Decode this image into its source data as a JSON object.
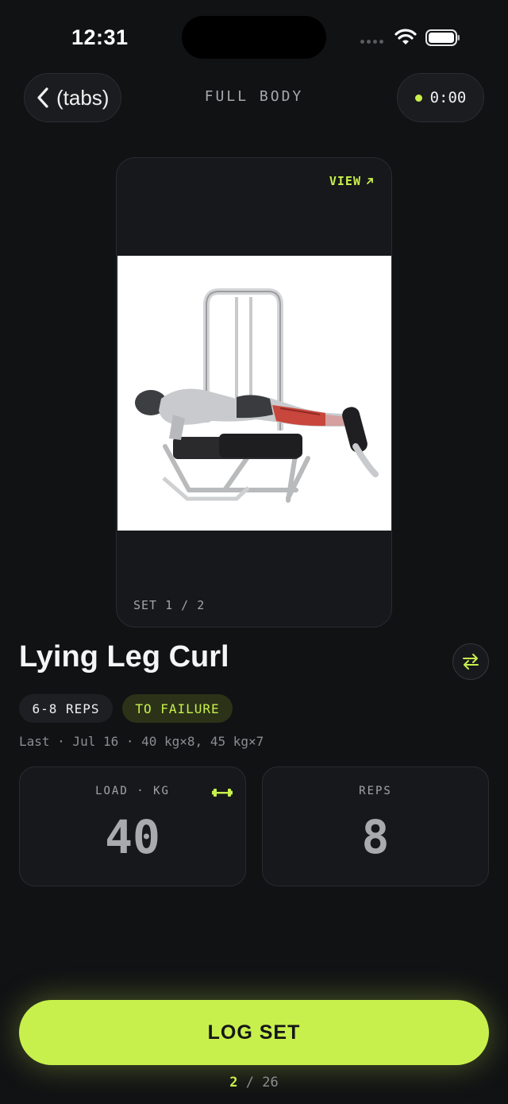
{
  "status_bar": {
    "time": "12:31",
    "signal_icon": "signal-dots-icon",
    "wifi_icon": "wifi-icon",
    "battery_icon": "battery-icon"
  },
  "header": {
    "back_label": "(tabs)",
    "workout_title": "FULL BODY",
    "timer": "0:00"
  },
  "exercise_card": {
    "view_label": "VIEW",
    "image": "lying-leg-curl-illustration",
    "set_counter": "SET 1 / 2"
  },
  "exercise": {
    "name": "Lying Leg Curl",
    "rep_range": "6-8 REPS",
    "intensity": "TO FAILURE",
    "last": "Last · Jul 16 · 40 kg×8, 45 kg×7"
  },
  "inputs": {
    "load": {
      "label": "LOAD · KG",
      "value": "40"
    },
    "reps": {
      "label": "REPS",
      "value": "8"
    }
  },
  "log_button": "LOG SET",
  "progress": {
    "current": "2",
    "total": "26"
  },
  "colors": {
    "accent": "#c8f04c",
    "background": "#111214",
    "card": "#17181b"
  }
}
